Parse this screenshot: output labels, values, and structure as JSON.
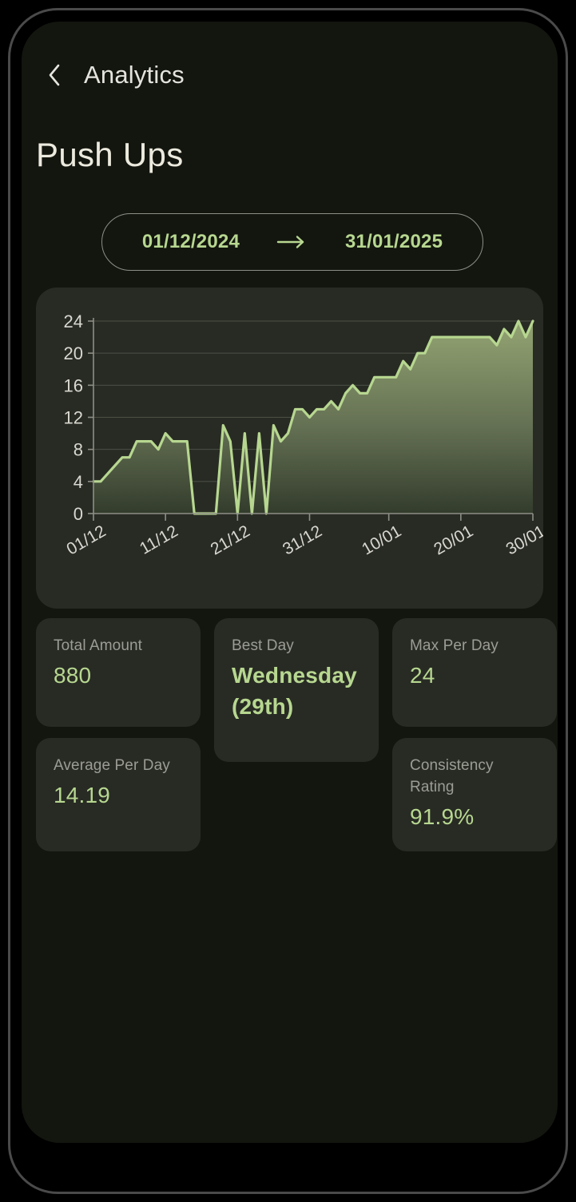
{
  "app_bar": {
    "back_icon": "chevron-left-icon",
    "title": "Analytics"
  },
  "page_title": "Push Ups",
  "date_range": {
    "start": "01/12/2024",
    "arrow_icon": "arrow-right-icon",
    "end": "31/01/2025"
  },
  "colors": {
    "accent_green": "#b7d790",
    "card_bg": "#282b24",
    "screen_bg": "#13160f",
    "label_gray": "#9b9d95",
    "title_white": "#eceade",
    "grid_line": "#4b5044",
    "axis_line": "#8d8f86",
    "area_fill_top": "#8fa06e",
    "area_fill_bottom": "#3b4433"
  },
  "chart_data": {
    "type": "area",
    "title": "",
    "xlabel": "",
    "ylabel": "",
    "ylim": [
      0,
      24
    ],
    "xlim": [
      0,
      61
    ],
    "grid": true,
    "legend": "none",
    "y_ticks": [
      0,
      4,
      8,
      12,
      16,
      20,
      24
    ],
    "x_tick_labels": [
      "01/12",
      "11/12",
      "21/12",
      "31/12",
      "10/01",
      "20/01",
      "30/01"
    ],
    "x_tick_indices": [
      0,
      10,
      20,
      30,
      41,
      51,
      61
    ],
    "x": [
      "01/12",
      "02/12",
      "03/12",
      "04/12",
      "05/12",
      "06/12",
      "07/12",
      "08/12",
      "09/12",
      "10/12",
      "11/12",
      "12/12",
      "13/12",
      "14/12",
      "15/12",
      "16/12",
      "17/12",
      "18/12",
      "19/12",
      "20/12",
      "21/12",
      "22/12",
      "23/12",
      "24/12",
      "25/12",
      "26/12",
      "27/12",
      "28/12",
      "29/12",
      "30/12",
      "31/12",
      "01/01",
      "02/01",
      "03/01",
      "04/01",
      "05/01",
      "06/01",
      "07/01",
      "08/01",
      "09/01",
      "10/01",
      "11/01",
      "12/01",
      "13/01",
      "14/01",
      "15/01",
      "16/01",
      "17/01",
      "18/01",
      "19/01",
      "20/01",
      "21/01",
      "22/01",
      "23/01",
      "24/01",
      "25/01",
      "26/01",
      "27/01",
      "28/01",
      "29/01",
      "30/01",
      "31/01"
    ],
    "values": [
      4,
      4,
      5,
      6,
      7,
      7,
      9,
      9,
      9,
      8,
      10,
      9,
      9,
      9,
      0,
      0,
      0,
      0,
      11,
      9,
      0,
      10,
      0,
      10,
      0,
      11,
      9,
      10,
      13,
      13,
      12,
      13,
      13,
      14,
      13,
      15,
      16,
      15,
      15,
      17,
      17,
      17,
      17,
      19,
      18,
      20,
      20,
      22,
      22,
      22,
      22,
      22,
      22,
      22,
      22,
      22,
      21,
      23,
      22,
      24,
      22,
      24
    ],
    "series_name": "Push Ups per day"
  },
  "stats": [
    {
      "id": "total-amount",
      "label": "Total Amount",
      "value": "880",
      "bold": false
    },
    {
      "id": "best-day",
      "label": "Best Day",
      "value": "Wednesday (29th)",
      "bold": true
    },
    {
      "id": "max-per-day",
      "label": "Max Per Day",
      "value": "24",
      "bold": false
    },
    {
      "id": "average-per-day",
      "label": "Average Per Day",
      "value": "14.19",
      "bold": false
    },
    {
      "id": "consistency",
      "label": "Consistency Rating",
      "value": "91.9%",
      "bold": false
    }
  ]
}
